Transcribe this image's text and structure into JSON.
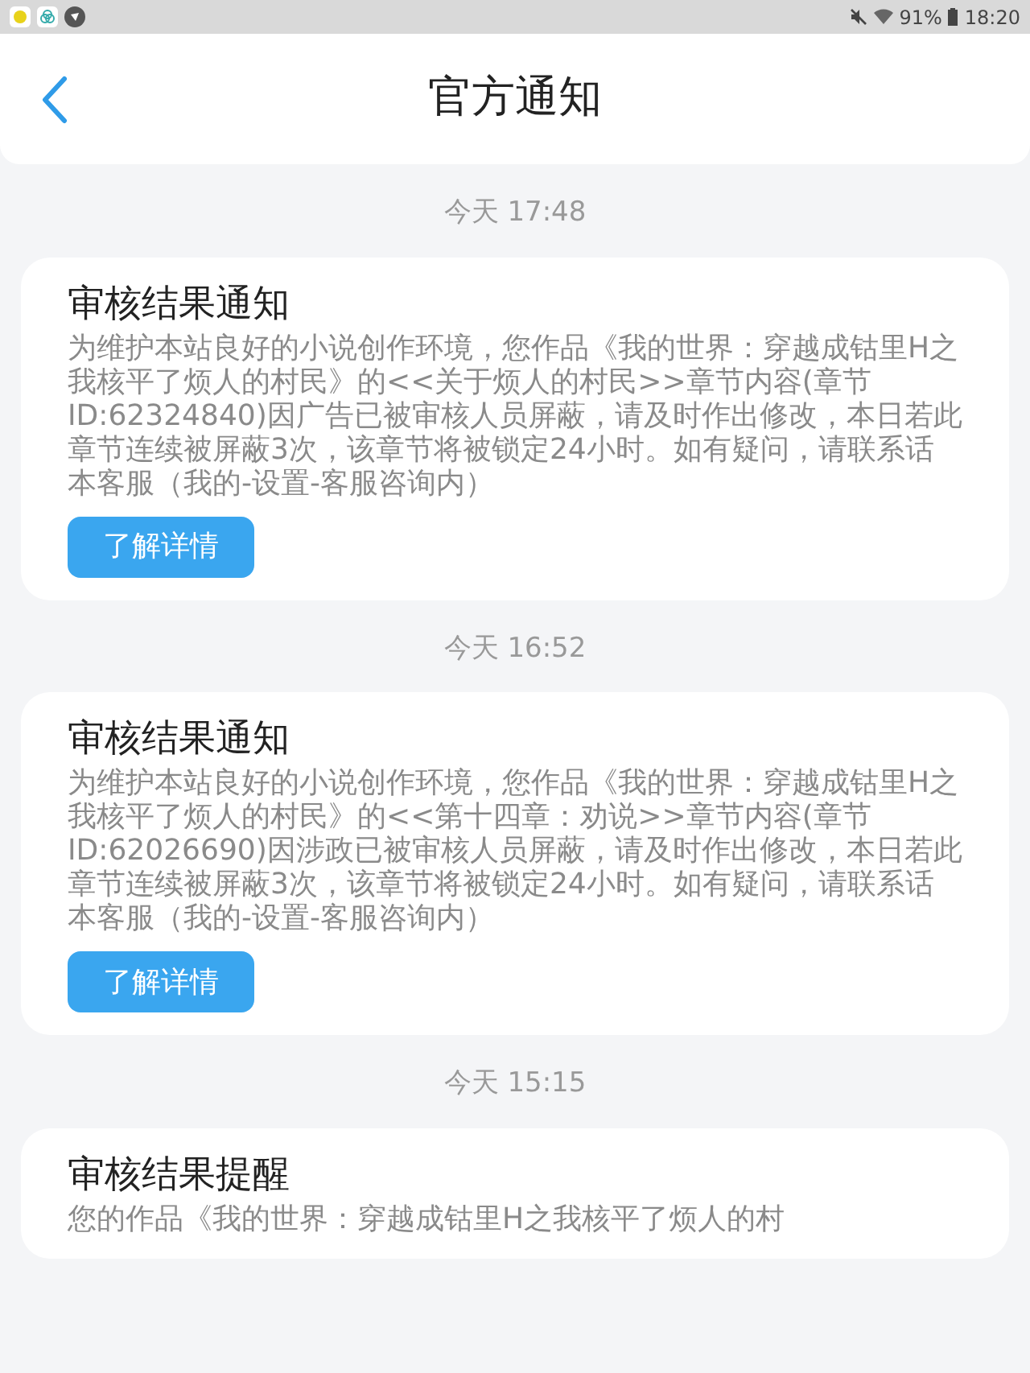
{
  "status_bar": {
    "battery": "91%",
    "time": "18:20"
  },
  "header": {
    "title": "官方通知"
  },
  "notices": [
    {
      "time": "今天 17:48",
      "title": "审核结果通知",
      "body": "为维护本站良好的小说创作环境，您作品《我的世界：穿越成钴里H之我核平了烦人的村民》的<<关于烦人的村民>>章节内容(章节ID:62324840)因广告已被审核人员屏蔽，请及时作出修改，本日若此章节连续被屏蔽3次，该章节将被锁定24小时。如有疑问，请联系话本客服（我的-设置-客服咨询内）",
      "button": "了解详情"
    },
    {
      "time": "今天 16:52",
      "title": "审核结果通知",
      "body": "为维护本站良好的小说创作环境，您作品《我的世界：穿越成钴里H之我核平了烦人的村民》的<<第十四章：劝说>>章节内容(章节ID:62026690)因涉政已被审核人员屏蔽，请及时作出修改，本日若此章节连续被屏蔽3次，该章节将被锁定24小时。如有疑问，请联系话本客服（我的-设置-客服咨询内）",
      "button": "了解详情"
    },
    {
      "time": "今天 15:15",
      "title": "审核结果提醒",
      "body": "您的作品《我的世界：穿越成钴里H之我核平了烦人的村"
    }
  ]
}
